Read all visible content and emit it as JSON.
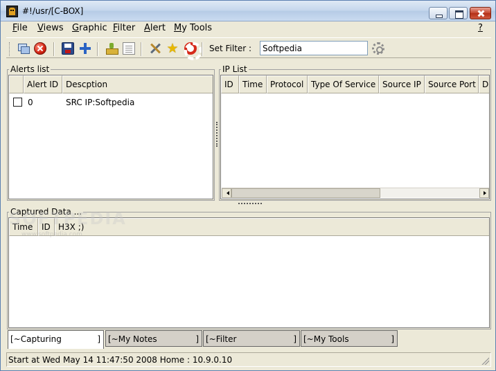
{
  "window": {
    "title": "#!/usr/[C-BOX]"
  },
  "menu": [
    "File",
    "Views",
    "Graphic",
    "Filter",
    "Alert",
    "My Tools"
  ],
  "menu_help": "?",
  "toolbar": {
    "filter_label": "Set Filter :",
    "filter_value": "Softpedia"
  },
  "alerts": {
    "title": "Alerts list",
    "columns": [
      "Alert ID",
      "Descption"
    ],
    "rows": [
      {
        "id": "0",
        "description": "SRC IP:Softpedia"
      }
    ]
  },
  "ip_list": {
    "title": "IP List",
    "columns": [
      "ID",
      "Time",
      "Protocol",
      "Type Of Service",
      "Source IP",
      "Source Port",
      "De"
    ]
  },
  "captured": {
    "title": "Captured Data ...",
    "columns": [
      "Time",
      "ID",
      "H3X ;)"
    ]
  },
  "tabs": [
    {
      "label": "[~Capturing",
      "close": "]"
    },
    {
      "label": "[~My Notes",
      "close": "]"
    },
    {
      "label": "[~Filter",
      "close": "]"
    },
    {
      "label": "[~My Tools",
      "close": "]"
    }
  ],
  "status": "Start at Wed May 14 11:47:50 2008 Home : 10.9.0.10",
  "watermark": {
    "main": "SOFTPEDIA",
    "sub": "www.softpedia.com"
  }
}
